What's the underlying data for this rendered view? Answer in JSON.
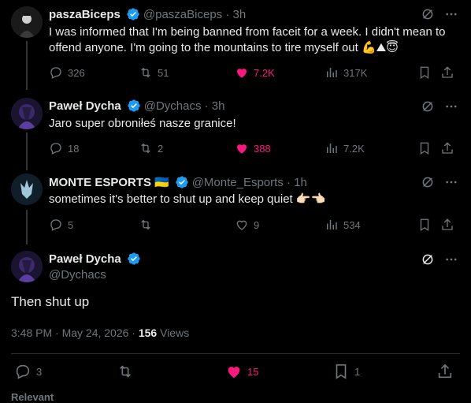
{
  "replies": [
    {
      "name": "paszaBiceps",
      "handle": "@paszaBiceps · 3h",
      "text": "I was informed that I'm being banned from faceit for a week. I didn't mean to offend anyone. I'm going to the mountains to tire myself out 💪⛰😇",
      "stats": {
        "replies": "326",
        "reposts": "51",
        "likes": "7.2K",
        "views": "317K"
      }
    },
    {
      "name": "Paweł Dycha",
      "handle": "@Dychacs · 3h",
      "text": "Jaro super obroniłeś nasze granice!",
      "stats": {
        "replies": "18",
        "reposts": "2",
        "likes": "388",
        "views": "7.2K"
      }
    },
    {
      "name": "MONTE ESPORTS",
      "flag": "🇺🇦",
      "handle": "@Monte_Esports · 1h",
      "text": "sometimes it's better to shut up and keep quiet 👉🏻👈🏻",
      "stats": {
        "replies": "5",
        "reposts": "",
        "likes": "9",
        "views": "534"
      }
    }
  ],
  "focus": {
    "name": "Paweł Dycha",
    "handle": "@Dychacs",
    "text": "Then shut up",
    "time": "3:48 PM · May 24, 2026 · ",
    "views_count": "156",
    "views_label": " Views",
    "stats": {
      "replies": "3",
      "likes": "15",
      "bookmarks": "1"
    }
  },
  "footer": {
    "relevant": "Relevant"
  },
  "colors": {
    "accent": "#1d9bf0",
    "like": "#f91880",
    "muted": "#71767b",
    "text": "#e7e9ea"
  }
}
